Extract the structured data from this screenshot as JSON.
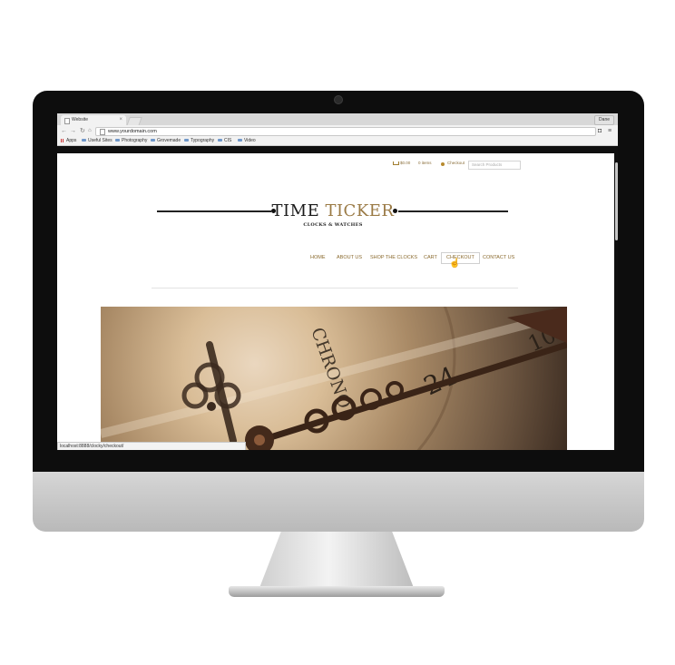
{
  "browser": {
    "tab_title": "Website",
    "tab_close": "×",
    "profile_label": "Dane",
    "address": "www.yourdomain.com",
    "bookmarks": [
      "Apps",
      "Useful Sites",
      "Photography",
      "Grovemade",
      "Typography",
      "CIS",
      "Video"
    ],
    "status_url": "localhost:8888/clocky/checkout/"
  },
  "site": {
    "cart_total": "$0.00",
    "cart_items": "0 items",
    "checkout_link": "Checkout",
    "search_placeholder": "Search Products",
    "logo_time": "TIME",
    "logo_ticker": "TICKER",
    "logo_sub": "CLOCKS & WATCHES",
    "menu": [
      "HOME",
      "ABOUT US",
      "SHOP THE CLOCKS",
      "CART",
      "CHECKOUT",
      "CONTACT US"
    ],
    "active_menu": "CHECKOUT",
    "hero_text": [
      "CHRONO",
      "24",
      "10"
    ]
  },
  "colors": {
    "accent_gold": "#8a6a2e",
    "logo_ticker": "#9a7a45",
    "monitor_bezel": "#0d0d0d",
    "hero_sepia": "#d9bd97"
  }
}
